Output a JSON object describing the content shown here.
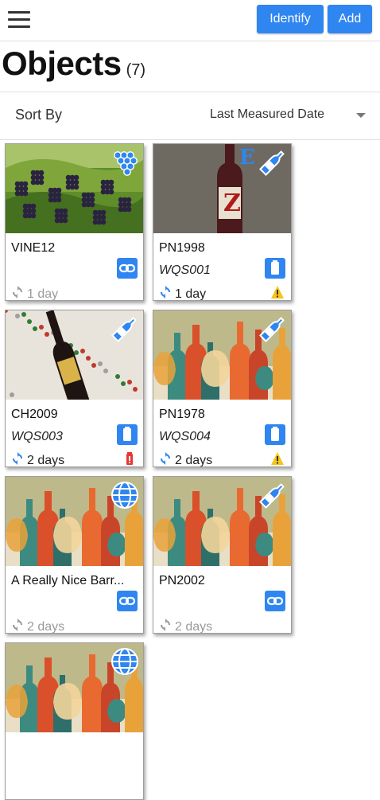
{
  "header": {
    "identify_label": "Identify",
    "add_label": "Add"
  },
  "page": {
    "title": "Objects",
    "count": "(7)"
  },
  "sort": {
    "label": "Sort By",
    "value": "Last Measured Date"
  },
  "colors": {
    "accent": "#2f86f0",
    "warning": "#f5c518",
    "battery": "#e53935"
  },
  "objects": [
    {
      "name": "VINE12",
      "wqs": "",
      "age": "1 day",
      "age_style": "stale",
      "image": "vineyard",
      "type_icon": "grapes-icon",
      "action_icon": "link-icon",
      "status_icon": ""
    },
    {
      "name": "PN1998",
      "wqs": "WQS001",
      "age": "1 day",
      "age_style": "fresh",
      "image": "wine-bottle-z",
      "type_icon": "bottle-icon",
      "action_icon": "sensor-icon",
      "status_icon": "warning-icon"
    },
    {
      "name": "CH2009",
      "wqs": "WQS003",
      "age": "2 days",
      "age_style": "fresh",
      "image": "wine-bottle-tablecloth",
      "type_icon": "bottle-icon",
      "action_icon": "sensor-icon",
      "status_icon": "low-battery-icon"
    },
    {
      "name": "PN1978",
      "wqs": "WQS004",
      "age": "2 days",
      "age_style": "fresh",
      "image": "bottles-illustration",
      "type_icon": "bottle-icon",
      "action_icon": "sensor-icon",
      "status_icon": "warning-icon"
    },
    {
      "name": "A Really Nice Barr...",
      "wqs": "",
      "age": "2 days",
      "age_style": "stale",
      "image": "bottles-illustration",
      "type_icon": "globe-icon",
      "action_icon": "link-icon",
      "status_icon": ""
    },
    {
      "name": "PN2002",
      "wqs": "",
      "age": "2 days",
      "age_style": "stale",
      "image": "bottles-illustration",
      "type_icon": "bottle-icon",
      "action_icon": "link-icon",
      "status_icon": ""
    },
    {
      "name": "",
      "wqs": "",
      "age": "",
      "age_style": "stale",
      "image": "bottles-illustration",
      "type_icon": "globe-icon",
      "action_icon": "",
      "status_icon": ""
    }
  ]
}
